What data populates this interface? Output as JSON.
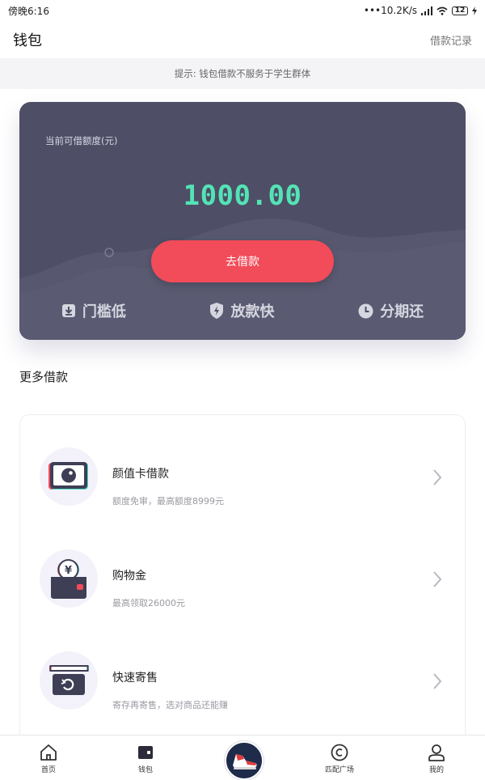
{
  "status_bar": {
    "time": "傍晚6:16",
    "network_speed": "•••10.2K/s",
    "battery": "12"
  },
  "header": {
    "title": "钱包",
    "loan_records": "借款记录"
  },
  "notice": "提示: 钱包借款不服务于学生群体",
  "credit_card": {
    "label": "当前可借额度(元)",
    "amount": "1000.00",
    "borrow_button": "去借款",
    "features": [
      {
        "label": "门槛低",
        "icon": "download-box-icon"
      },
      {
        "label": "放款快",
        "icon": "lightning-shield-icon"
      },
      {
        "label": "分期还",
        "icon": "clock-icon"
      }
    ]
  },
  "more_loans": {
    "title": "更多借款",
    "items": [
      {
        "name": "颜值卡借款",
        "desc": "额度免审，最高额度8999元",
        "icon": "face-card-icon"
      },
      {
        "name": "购物金",
        "desc": "最高领取26000元",
        "icon": "yen-wallet-icon"
      },
      {
        "name": "快速寄售",
        "desc": "寄存再寄售，选对商品还能赚",
        "icon": "consign-box-icon"
      }
    ]
  },
  "bottom_nav": {
    "items": [
      {
        "label": "首页",
        "icon": "home-icon"
      },
      {
        "label": "钱包",
        "icon": "wallet-icon"
      },
      {
        "label": "",
        "icon": "sneaker-icon"
      },
      {
        "label": "匹配广场",
        "icon": "smile-circle-icon"
      },
      {
        "label": "我的",
        "icon": "user-icon"
      }
    ]
  },
  "colors": {
    "card_bg": "#4e4e66",
    "amount_green": "#53e3b5",
    "borrow_red": "#f24b59",
    "icon_bg": "#f3f2fb"
  }
}
